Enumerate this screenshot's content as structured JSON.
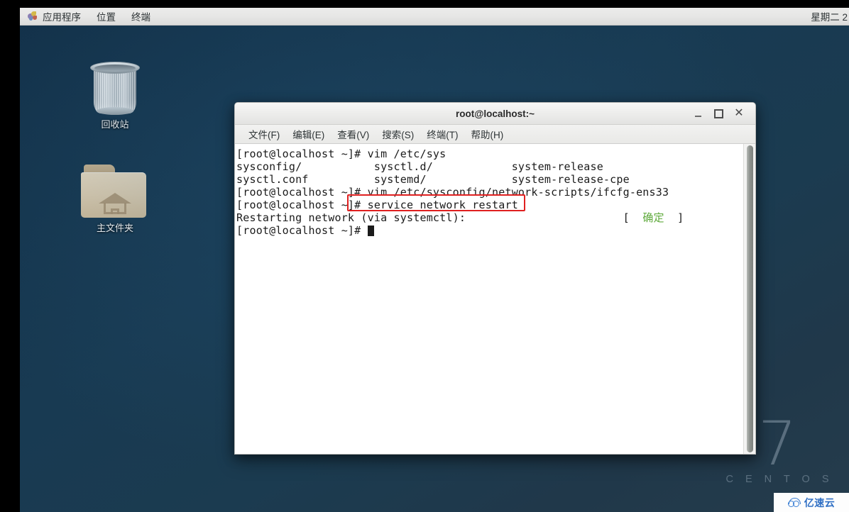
{
  "panel": {
    "logo_icon": "gnome-foot-icon",
    "items": [
      {
        "label": "应用程序"
      },
      {
        "label": "位置"
      },
      {
        "label": "终端"
      }
    ],
    "clock": "星期二 2"
  },
  "desktop": {
    "icons": [
      {
        "name": "trash",
        "label": "回收站",
        "icon": "trash-bin-icon"
      },
      {
        "name": "home",
        "label": "主文件夹",
        "icon": "home-folder-icon"
      }
    ],
    "watermark": {
      "version": "7",
      "product": "C E N T O S"
    },
    "badge": {
      "text": "亿速云",
      "icon": "cloud-logo-icon"
    }
  },
  "terminal": {
    "title": "root@localhost:~",
    "window_buttons": {
      "minimize": "_",
      "maximize": "□",
      "close": "✕"
    },
    "menu": [
      {
        "label": "文件(F)"
      },
      {
        "label": "编辑(E)"
      },
      {
        "label": "查看(V)"
      },
      {
        "label": "搜索(S)"
      },
      {
        "label": "终端(T)"
      },
      {
        "label": "帮助(H)"
      }
    ],
    "lines": {
      "l1": "[root@localhost ~]# vim /etc/sys",
      "l2": "sysconfig/           sysctl.d/            system-release",
      "l3": "sysctl.conf          systemd/             system-release-cpe",
      "l4": "[root@localhost ~]# vim /etc/sysconfig/network-scripts/ifcfg-ens33",
      "l5": "[root@localhost ~]# service network restart",
      "l6_pre": "Restarting network (via systemctl):                        [  ",
      "l6_status": "确定",
      "l6_post": "  ]",
      "l7": "[root@localhost ~]# "
    },
    "annotation": {
      "name": "red-highlight-box",
      "color": "#e02020",
      "target": "# service network restart"
    }
  }
}
